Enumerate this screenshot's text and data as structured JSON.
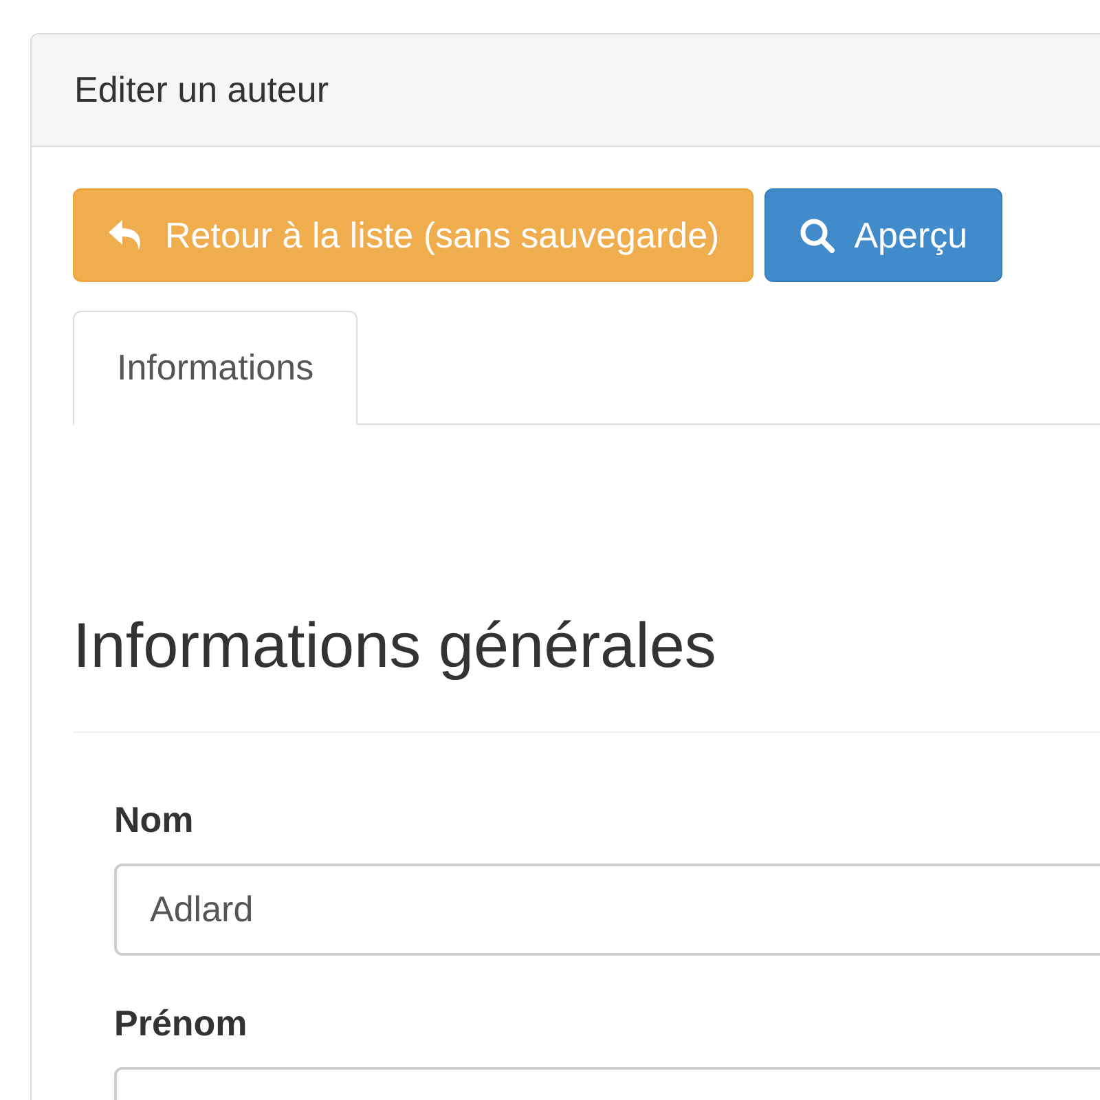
{
  "panel": {
    "title": "Editer un auteur"
  },
  "buttons": [
    {
      "label": "Retour à la liste (sans sauvegarde)",
      "kind": "back"
    },
    {
      "label": "Aperçu",
      "kind": "preview"
    }
  ],
  "tabs": [
    {
      "label": "Informations",
      "selected": true
    }
  ],
  "section": {
    "heading": "Informations générales"
  },
  "fields": [
    {
      "label": "Nom",
      "value": "Adlard"
    },
    {
      "label": "Prénom"
    }
  ]
}
